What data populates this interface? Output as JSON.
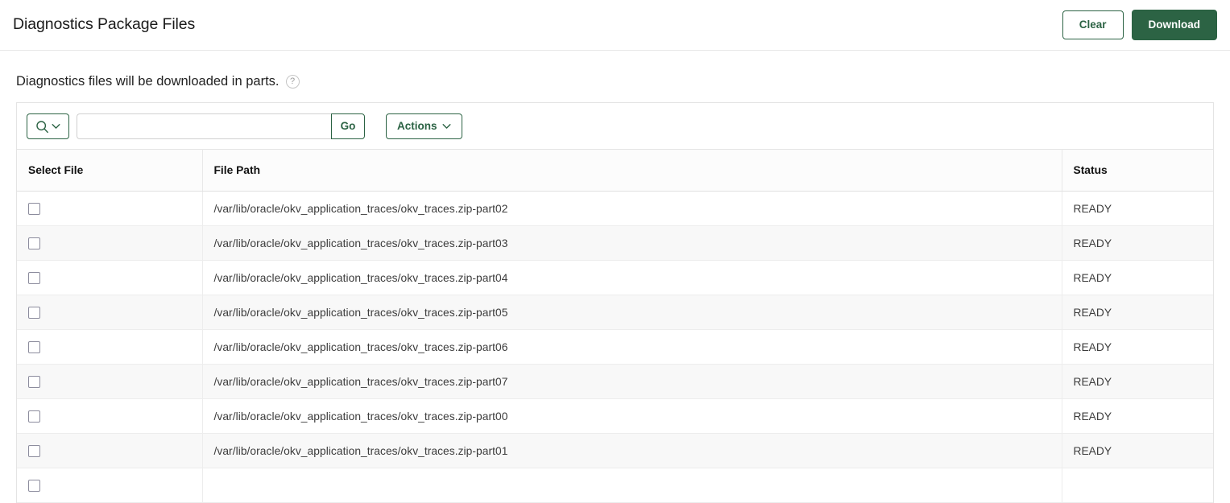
{
  "header": {
    "title": "Diagnostics Package Files",
    "clear_label": "Clear",
    "download_label": "Download"
  },
  "notice": {
    "text": "Diagnostics files will be downloaded in parts.",
    "help_glyph": "?"
  },
  "toolbar": {
    "search_value": "",
    "search_placeholder": "",
    "go_label": "Go",
    "actions_label": "Actions"
  },
  "table": {
    "columns": {
      "select": "Select File",
      "path": "File Path",
      "status": "Status"
    },
    "rows": [
      {
        "path": "/var/lib/oracle/okv_application_traces/okv_traces.zip-part02",
        "status": "READY",
        "checked": false
      },
      {
        "path": "/var/lib/oracle/okv_application_traces/okv_traces.zip-part03",
        "status": "READY",
        "checked": false
      },
      {
        "path": "/var/lib/oracle/okv_application_traces/okv_traces.zip-part04",
        "status": "READY",
        "checked": false
      },
      {
        "path": "/var/lib/oracle/okv_application_traces/okv_traces.zip-part05",
        "status": "READY",
        "checked": false
      },
      {
        "path": "/var/lib/oracle/okv_application_traces/okv_traces.zip-part06",
        "status": "READY",
        "checked": false
      },
      {
        "path": "/var/lib/oracle/okv_application_traces/okv_traces.zip-part07",
        "status": "READY",
        "checked": false
      },
      {
        "path": "/var/lib/oracle/okv_application_traces/okv_traces.zip-part00",
        "status": "READY",
        "checked": false
      },
      {
        "path": "/var/lib/oracle/okv_application_traces/okv_traces.zip-part01",
        "status": "READY",
        "checked": false
      },
      {
        "path": "",
        "status": "",
        "checked": false
      }
    ]
  },
  "colors": {
    "accent_green": "#2c6344",
    "text": "#252525",
    "row_stripe": "#f8f8f8",
    "border": "#e4e4e4"
  }
}
